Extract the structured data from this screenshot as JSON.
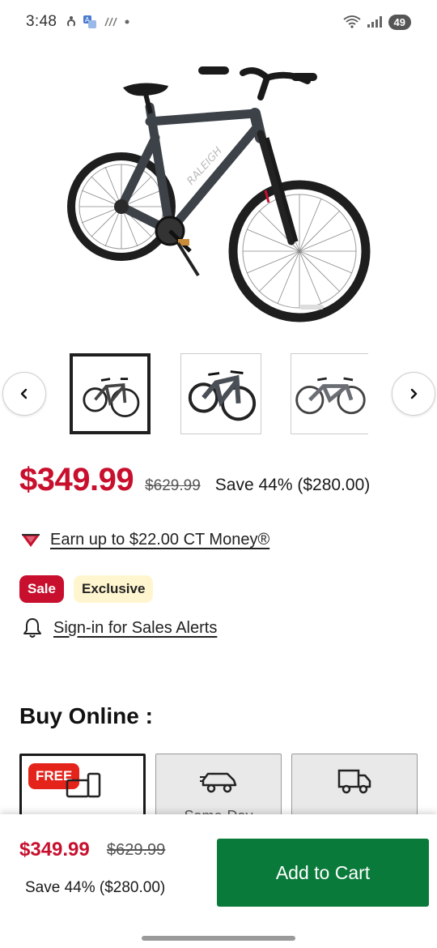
{
  "status_bar": {
    "time": "3:48",
    "battery": "49"
  },
  "product": {
    "price": "$349.99",
    "old_price": "$629.99",
    "save_text": "Save 44% ($280.00)",
    "ct_money_link": "Earn up to $22.00 CT Money®",
    "badges": [
      "Sale",
      "Exclusive"
    ],
    "alerts_link": "Sign-in for Sales Alerts",
    "thumbnails": [
      "bike-thumb-1",
      "bike-thumb-2",
      "bike-thumb-3"
    ]
  },
  "buy_online": {
    "title": "Buy Online :",
    "options": [
      {
        "badge": "FREE",
        "icon": "pickup-icon",
        "label": ""
      },
      {
        "badge": "",
        "icon": "car-icon",
        "label": "Same-Day"
      },
      {
        "badge": "",
        "icon": "truck-icon",
        "label": ""
      }
    ]
  },
  "sticky_bar": {
    "price": "$349.99",
    "old_price": "$629.99",
    "save_text": "Save 44% ($280.00)",
    "add_to_cart": "Add to Cart"
  },
  "colors": {
    "sale_red": "#c8102e",
    "cart_green": "#0a7a3a",
    "exclusive_bg": "#fff6cf"
  }
}
